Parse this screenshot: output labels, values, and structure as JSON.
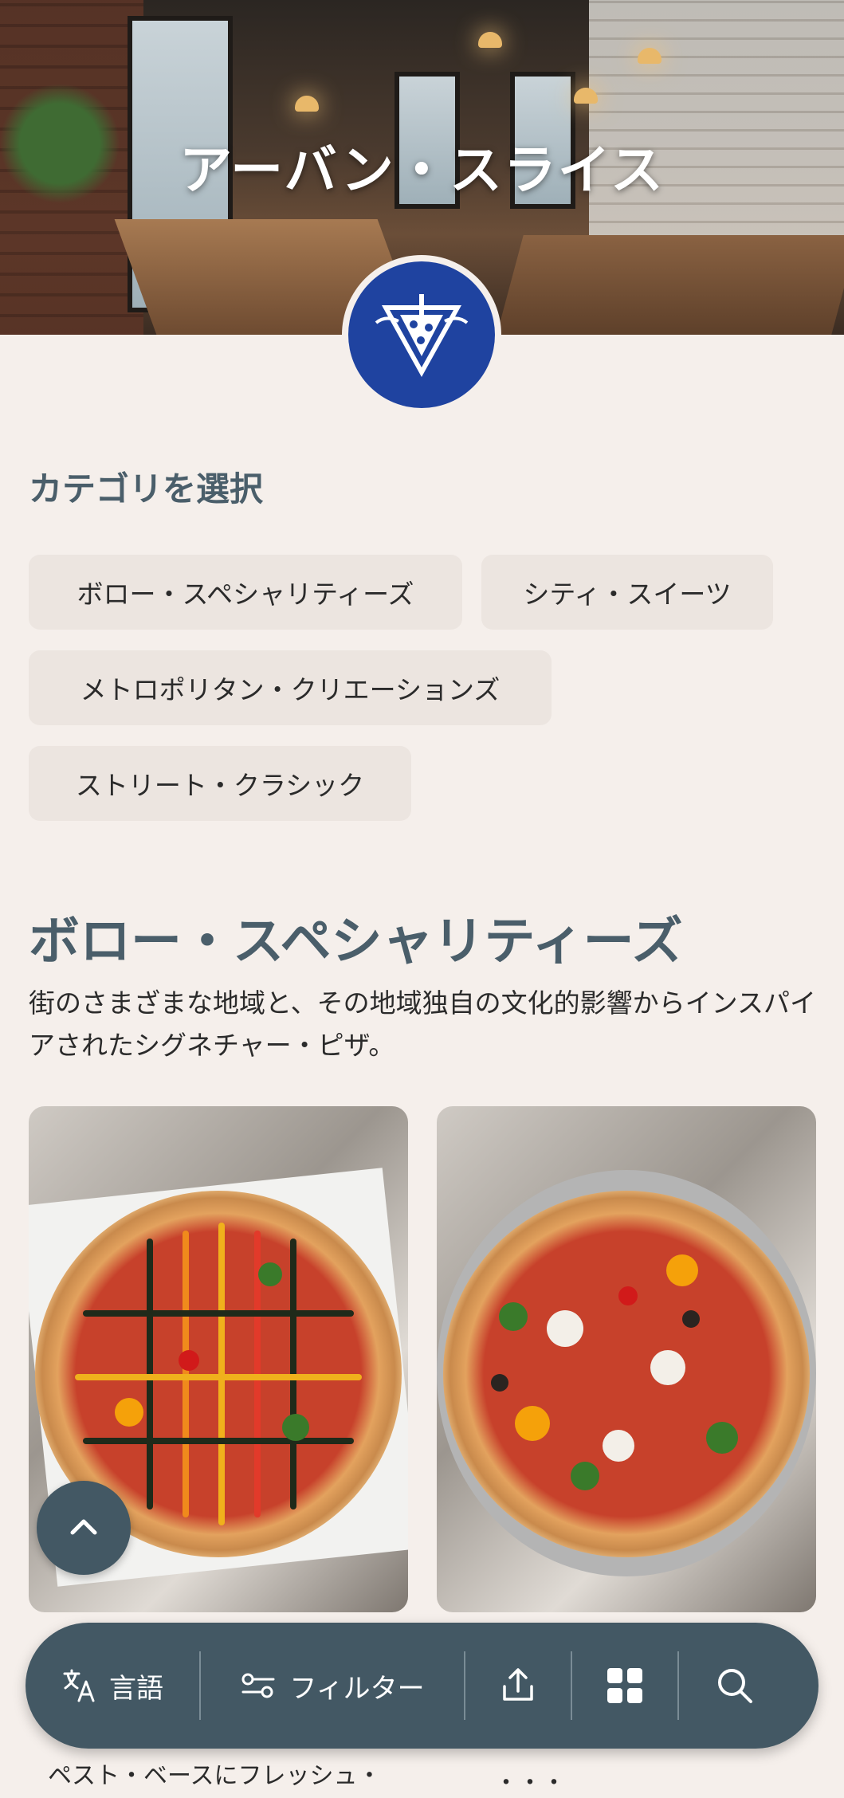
{
  "hero": {
    "title": "アーバン・スライス"
  },
  "category": {
    "heading": "カテゴリを選択",
    "chips": [
      "ボロー・スペシャリティーズ",
      "シティ・スイーツ",
      "メトロポリタン・クリエーションズ",
      "ストリート・クラシック"
    ]
  },
  "section": {
    "title": "ボロー・スペシャリティーズ",
    "description": "街のさまざまな地域と、その地域独自の文化的影響からインスパイアされたシグネチャー・ピザ。"
  },
  "peek_text": {
    "left": "ペスト・ベースにフレッシュ・",
    "right": "・・・"
  },
  "bottom_bar": {
    "language_label": "言語",
    "filter_label": "フィルター",
    "icons": [
      "translate-icon",
      "filter-icon",
      "share-icon",
      "grid-icon",
      "search-icon"
    ]
  },
  "colors": {
    "background": "#f5efeb",
    "accent": "#435864",
    "heading": "#4a5e6a",
    "chip": "#ece5e0",
    "logo": "#1f43a0"
  }
}
